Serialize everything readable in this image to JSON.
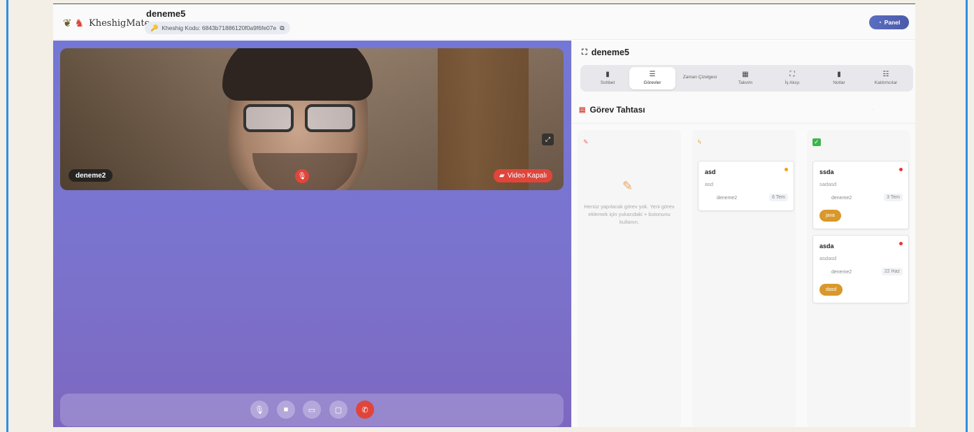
{
  "header": {
    "brand": "KheshigMate",
    "room_title": "deneme5",
    "room_code": "Kheshig Kodu: 6843b71886120f0a9f6fe07e",
    "panel_button": "Panel"
  },
  "video": {
    "participant_name": "deneme2",
    "video_off_label": "Video Kapalı"
  },
  "side": {
    "title": "deneme5",
    "tabs": [
      {
        "label": "Sohbet",
        "icon": "chat-icon"
      },
      {
        "label": "Görevler",
        "icon": "tasks-icon"
      },
      {
        "label": "Zaman Çizelgesi",
        "icon": ""
      },
      {
        "label": "Takvim",
        "icon": "calendar-icon"
      },
      {
        "label": "İş Akışı",
        "icon": "workflow-icon"
      },
      {
        "label": "Notlar",
        "icon": "notes-icon"
      },
      {
        "label": "Katılımcılar",
        "icon": "users-icon"
      }
    ],
    "active_tab": "Görevler",
    "board_title": "Görev Tahtası",
    "empty_text": "Henüz yapılacak görev yok. Yeni görev eklemek için yukarıdaki + butonunu kullanın.",
    "cards": {
      "doing": [
        {
          "title": "asd",
          "desc": "asd",
          "user": "deneme2",
          "date": "6 Tem",
          "priority_color": "#f0a020"
        }
      ],
      "done": [
        {
          "title": "ssda",
          "desc": "sadasd",
          "user": "deneme2",
          "date": "3 Tem",
          "tag": "java",
          "priority_color": "#e53935"
        },
        {
          "title": "asda",
          "desc": "asdasd",
          "user": "deneme2",
          "date": "22 Haz",
          "tag": "dasd",
          "priority_color": "#e53935"
        }
      ]
    }
  },
  "colors": {
    "accent": "#5b6ec2",
    "danger": "#e0453b",
    "tag": "#d9982a",
    "video_bg": "#7477d4"
  }
}
